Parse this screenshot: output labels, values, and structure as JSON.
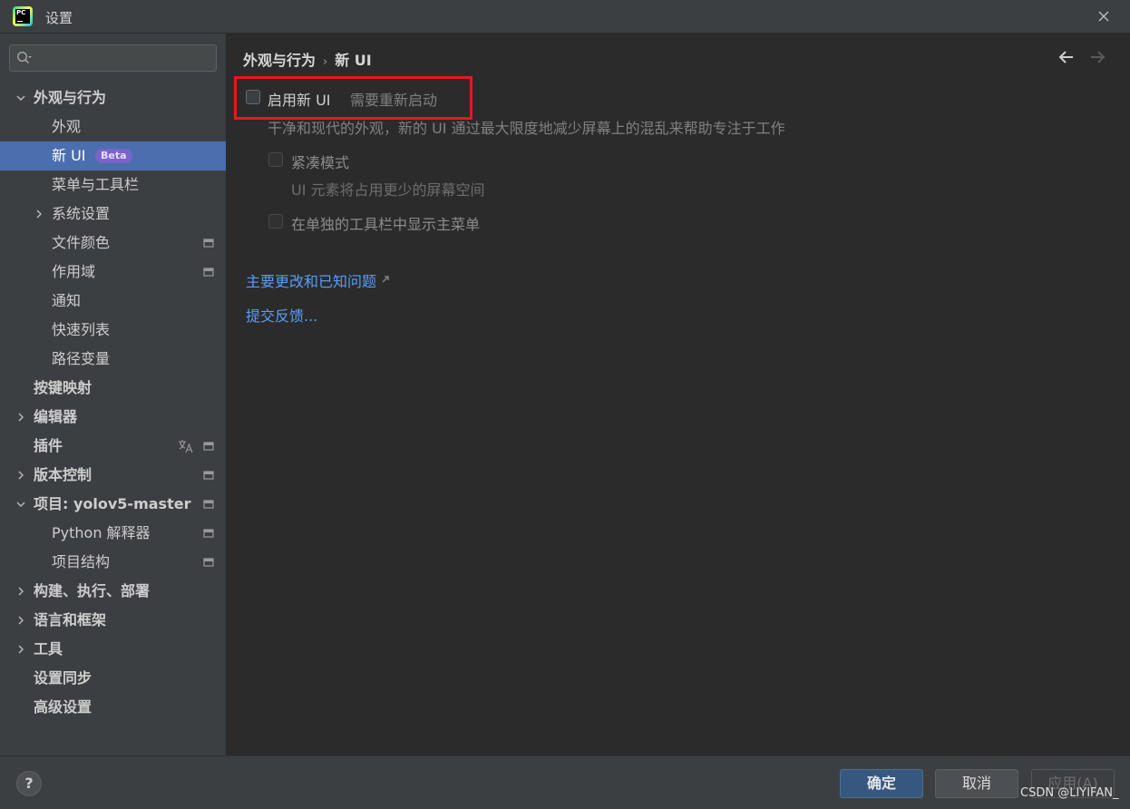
{
  "window": {
    "title": "设置"
  },
  "search": {
    "placeholder": ""
  },
  "sidebar": {
    "items": [
      {
        "label": "外观与行为"
      },
      {
        "label": "外观"
      },
      {
        "label": "新 UI",
        "badge": "Beta"
      },
      {
        "label": "菜单与工具栏"
      },
      {
        "label": "系统设置"
      },
      {
        "label": "文件颜色"
      },
      {
        "label": "作用域"
      },
      {
        "label": "通知"
      },
      {
        "label": "快速列表"
      },
      {
        "label": "路径变量"
      },
      {
        "label": "按键映射"
      },
      {
        "label": "编辑器"
      },
      {
        "label": "插件"
      },
      {
        "label": "版本控制"
      },
      {
        "label": "项目: yolov5-master"
      },
      {
        "label": "Python 解释器"
      },
      {
        "label": "项目结构"
      },
      {
        "label": "构建、执行、部署"
      },
      {
        "label": "语言和框架"
      },
      {
        "label": "工具"
      },
      {
        "label": "设置同步"
      },
      {
        "label": "高级设置"
      }
    ]
  },
  "main": {
    "breadcrumb": {
      "parent": "外观与行为",
      "separator": "›",
      "current": "新 UI"
    },
    "enable_new_ui": {
      "label": "启用新 UI",
      "note": "需要重新启动",
      "checked": false
    },
    "description": "干净和现代的外观，新的 UI 通过最大限度地减少屏幕上的混乱来帮助专注于工作",
    "compact_mode": {
      "label": "紧凑模式",
      "hint": "UI 元素将占用更少的屏幕空间",
      "checked": false
    },
    "main_menu_toolbar": {
      "label": "在单独的工具栏中显示主菜单",
      "checked": false
    },
    "links": {
      "changes": "主要更改和已知问题",
      "feedback": "提交反馈..."
    }
  },
  "footer": {
    "help": "?",
    "ok": "确定",
    "cancel": "取消",
    "apply": "应用(A)",
    "watermark": "CSDN @LIYIFAN_"
  },
  "colors": {
    "accent_selection": "#4b6eaf",
    "link": "#589df6",
    "highlight_box": "#e5191f",
    "beta_badge": "#7a64c9"
  }
}
